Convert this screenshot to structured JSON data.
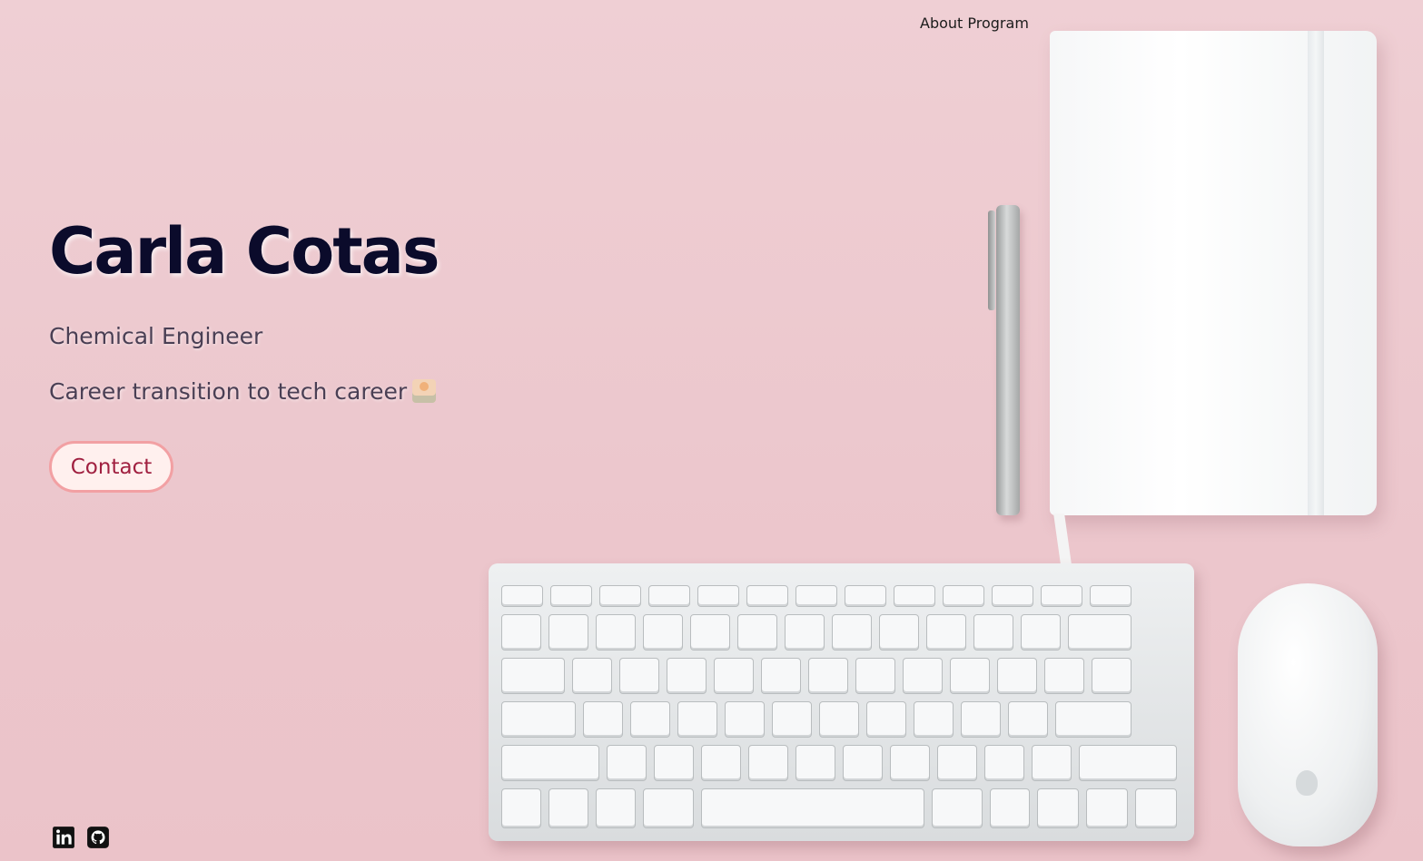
{
  "nav": {
    "about_label": "About Program"
  },
  "hero": {
    "name": "Carla Cotas",
    "title": "Chemical Engineer",
    "tagline": "Career transition to tech career"
  },
  "contact": {
    "button_label": "Contact"
  },
  "social": {
    "linkedin_icon": "linkedin-icon",
    "github_icon": "github-icon"
  },
  "colors": {
    "background": "#ecc8ce",
    "heading": "#0b0b2b",
    "body_text": "#4a3f54",
    "button_text": "#a02040",
    "button_border": "#f2a0a3",
    "button_bg": "#fff0ee"
  }
}
